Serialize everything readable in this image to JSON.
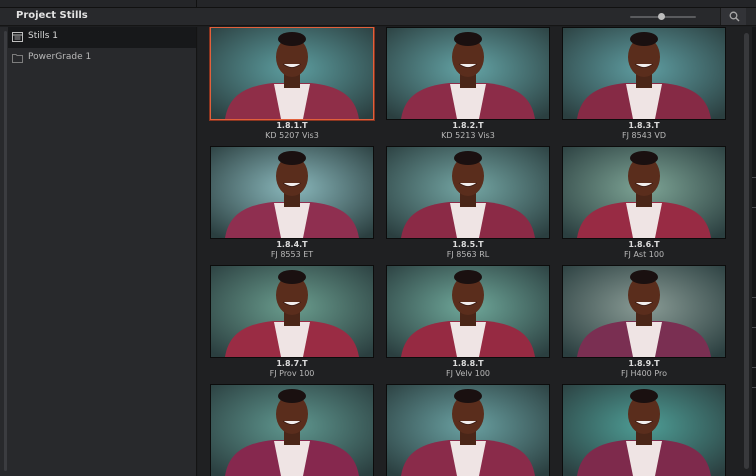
{
  "header": {
    "title": "Project Stills"
  },
  "sidebar": {
    "albums": [
      {
        "label": "Stills 1",
        "selected": true
      },
      {
        "label": "PowerGrade 1",
        "selected": false
      }
    ]
  },
  "stills": [
    {
      "id": "1.8.1.T",
      "label": "KD 5207 Vis3",
      "selected": true,
      "bg": "#5d9ea0",
      "sweater": "#8f2e48"
    },
    {
      "id": "1.8.2.T",
      "label": "KD 5213 Vis3",
      "selected": false,
      "bg": "#64a4a6",
      "sweater": "#8c2c48"
    },
    {
      "id": "1.8.3.T",
      "label": "FJ 8543 VD",
      "selected": false,
      "bg": "#5f9ea2",
      "sweater": "#862a45"
    },
    {
      "id": "1.8.4.T",
      "label": "FJ 8553 ET",
      "selected": false,
      "bg": "#8ab8bc",
      "sweater": "#8f2f50"
    },
    {
      "id": "1.8.5.T",
      "label": "FJ 8563 RL",
      "selected": false,
      "bg": "#74a6a4",
      "sweater": "#8b2a46"
    },
    {
      "id": "1.8.6.T",
      "label": "FJ Ast 100",
      "selected": false,
      "bg": "#7ea596",
      "sweater": "#982b44"
    },
    {
      "id": "1.8.7.T",
      "label": "FJ Prov 100",
      "selected": false,
      "bg": "#6a9d8e",
      "sweater": "#9a2c44"
    },
    {
      "id": "1.8.8.T",
      "label": "FJ Velv 100",
      "selected": false,
      "bg": "#6fa89a",
      "sweater": "#962a42"
    },
    {
      "id": "1.8.9.T",
      "label": "FJ H400 Pro",
      "selected": false,
      "bg": "#8a9c96",
      "sweater": "#7a2f52"
    },
    {
      "id": "",
      "label": "",
      "selected": false,
      "bg": "#5f978f",
      "sweater": "#86284e"
    },
    {
      "id": "",
      "label": "",
      "selected": false,
      "bg": "#6aa1a2",
      "sweater": "#8a2b4a"
    },
    {
      "id": "",
      "label": "",
      "selected": false,
      "bg": "#4e9e96",
      "sweater": "#7e2a4c"
    }
  ],
  "icons": {
    "album_selected": "album-icon",
    "album": "folder-icon",
    "search": "search-icon"
  }
}
